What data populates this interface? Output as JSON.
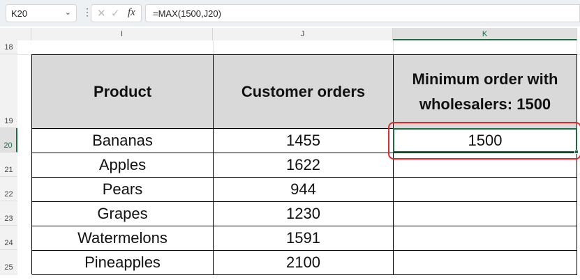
{
  "formula_bar": {
    "name_box": "K20",
    "formula": "=MAX(1500,J20)",
    "fx_label": "fx"
  },
  "columns": [
    "I",
    "J",
    "K"
  ],
  "row_numbers": [
    "18",
    "19",
    "20",
    "21",
    "22",
    "23",
    "24",
    "25"
  ],
  "table": {
    "headers": [
      "Product",
      "Customer orders",
      "Minimum order with wholesalers: 1500"
    ],
    "rows": [
      [
        "Bananas",
        "1455",
        "1500"
      ],
      [
        "Apples",
        "1622",
        ""
      ],
      [
        "Pears",
        "944",
        ""
      ],
      [
        "Grapes",
        "1230",
        ""
      ],
      [
        "Watermelons",
        "1591",
        ""
      ],
      [
        "Pineapples",
        "2100",
        ""
      ]
    ]
  }
}
